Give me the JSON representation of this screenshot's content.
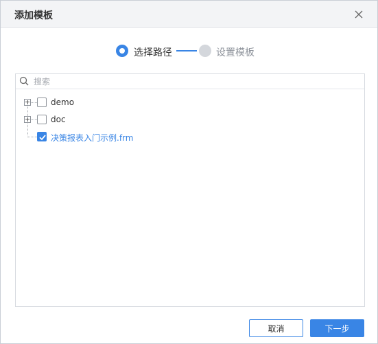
{
  "dialog": {
    "title": "添加模板"
  },
  "steps": [
    {
      "label": "选择路径",
      "state": "active"
    },
    {
      "label": "设置模板",
      "state": "inactive"
    }
  ],
  "search": {
    "placeholder": "搜索",
    "value": ""
  },
  "tree": {
    "nodes": [
      {
        "label": "demo",
        "type": "folder",
        "expandable": true,
        "checked": false
      },
      {
        "label": "doc",
        "type": "folder",
        "expandable": true,
        "checked": false
      },
      {
        "label": "决策报表入门示例.frm",
        "type": "file",
        "expandable": false,
        "checked": true
      }
    ]
  },
  "footer": {
    "cancel_label": "取消",
    "next_label": "下一步"
  },
  "colors": {
    "accent": "#3985e5",
    "inactive_step": "#d4d7dc",
    "header_bg": "#f3f4f6"
  }
}
